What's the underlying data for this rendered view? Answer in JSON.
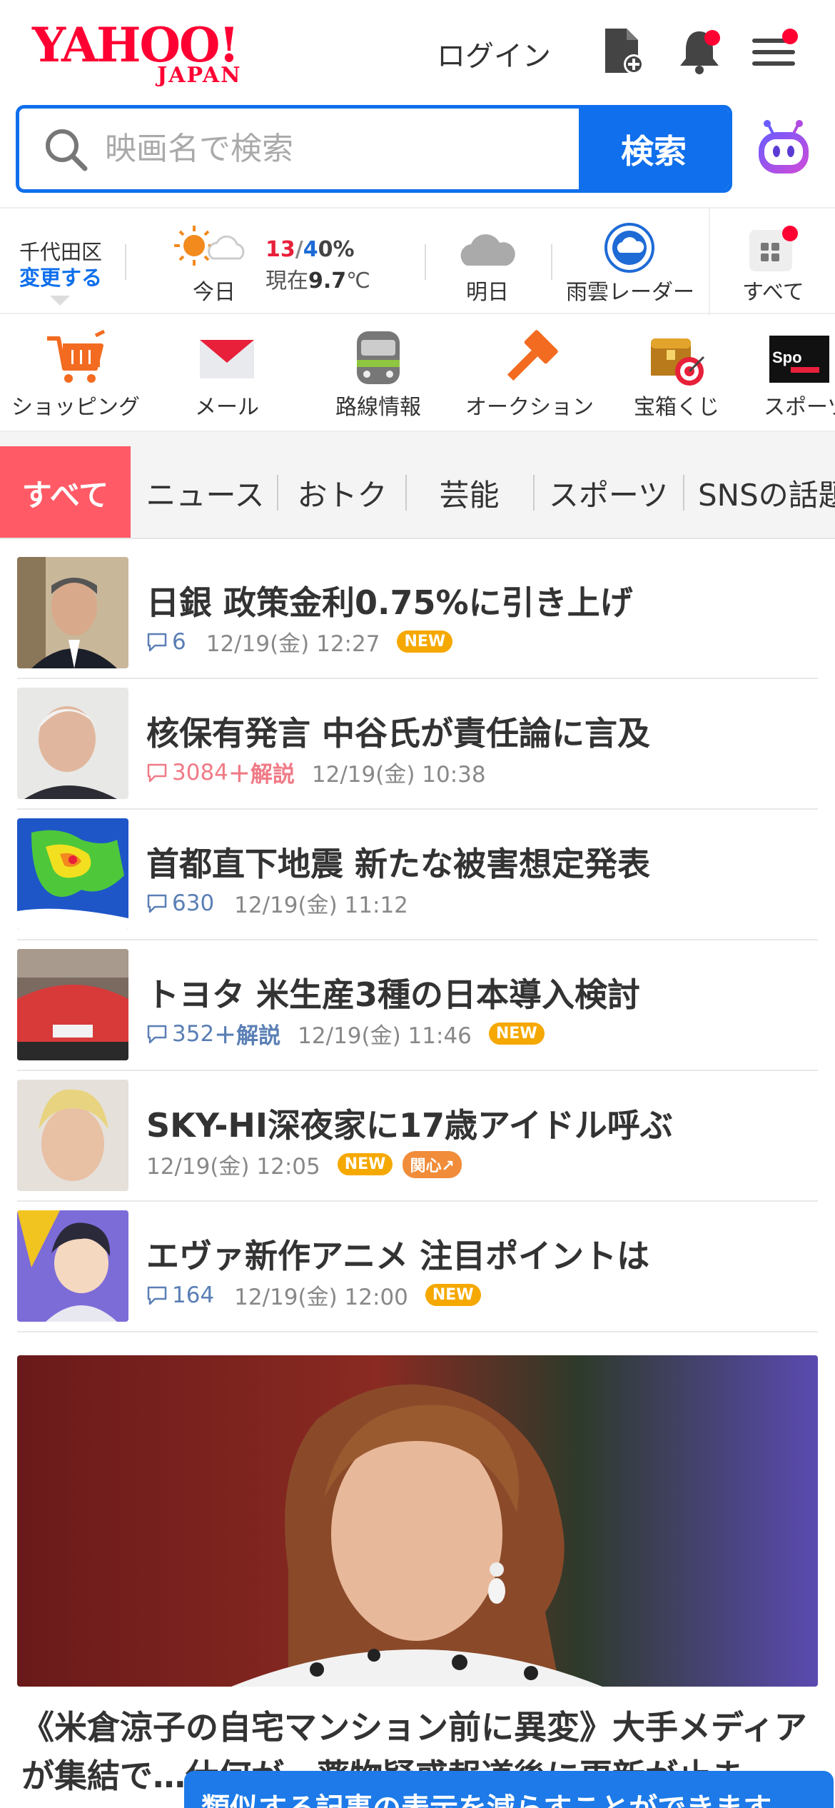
{
  "header": {
    "logo_text": "YAHOO!",
    "logo_sub": "JAPAN",
    "login_label": "ログイン",
    "icons": [
      "document-add-icon",
      "bell-icon",
      "menu-icon"
    ]
  },
  "search": {
    "placeholder": "映画名で検索",
    "button_label": "検索",
    "assistant_icon": "ai-assistant-icon"
  },
  "weather": {
    "location": "千代田区",
    "change_label": "変更する",
    "today_label": "今日",
    "temp_high": "13",
    "temp_low": "4",
    "rain_chance": "0%",
    "now_prefix": "現在",
    "now_value": "9.7",
    "now_unit": "℃",
    "tomorrow_label": "明日",
    "radar_label": "雨雲レーダー",
    "all_label": "すべて"
  },
  "services": [
    {
      "label": "ショッピング",
      "icon": "cart-icon"
    },
    {
      "label": "メール",
      "icon": "mail-icon"
    },
    {
      "label": "路線情報",
      "icon": "train-icon"
    },
    {
      "label": "オークション",
      "icon": "gavel-icon"
    },
    {
      "label": "宝箱くじ",
      "icon": "treasure-icon"
    },
    {
      "label": "スポーツ",
      "icon": "sports-icon"
    }
  ],
  "tabs": [
    {
      "label": "すべて",
      "active": true
    },
    {
      "label": "ニュース"
    },
    {
      "label": "おトク"
    },
    {
      "label": "芸能"
    },
    {
      "label": "スポーツ"
    },
    {
      "label": "SNSの話題"
    }
  ],
  "news": [
    {
      "title": "日銀 政策金利0.75%に引き上げ",
      "comments": "6",
      "time": "12/19(金) 12:27",
      "badge": "NEW"
    },
    {
      "title": "核保有発言 中谷氏が責任論に言及",
      "comments": "3084",
      "extra": "＋解説",
      "time": "12/19(金) 10:38"
    },
    {
      "title": "首都直下地震 新たな被害想定発表",
      "comments": "630",
      "time": "12/19(金) 11:12"
    },
    {
      "title": "トヨタ 米生産3種の日本導入検討",
      "comments": "352",
      "extra": "＋解説",
      "time": "12/19(金) 11:46",
      "badge": "NEW"
    },
    {
      "title": "SKY-HI深夜家に17歳アイドル呼ぶ",
      "time": "12/19(金) 12:05",
      "badge": "NEW",
      "badge2": "関心↗"
    },
    {
      "title": "エヴァ新作アニメ 注目ポイントは",
      "comments": "164",
      "time": "12/19(金) 12:00",
      "badge": "NEW"
    }
  ],
  "featured": {
    "title": "《米倉涼子の自宅マンション前に異変》大手メディアが集結で…仕何が…薬物疑惑報道後に更新が止ま"
  },
  "toast": {
    "text": "類似する記事の表示を減らすことができます"
  },
  "colors": {
    "brand_red": "#ff0033",
    "search_blue": "#0f6fec",
    "tab_active": "#ff5a66",
    "badge_new": "#f5a800"
  }
}
